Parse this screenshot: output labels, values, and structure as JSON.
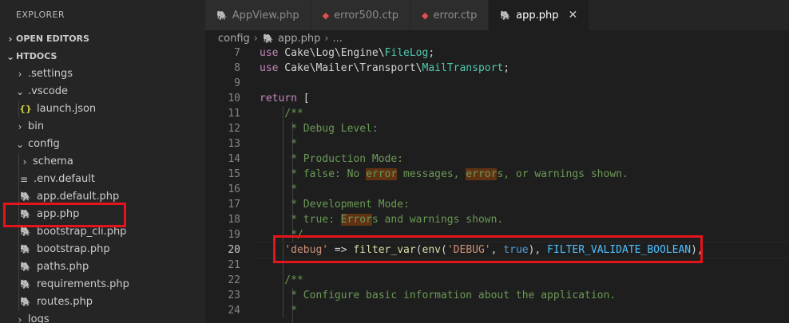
{
  "sidebar": {
    "title": "EXPLORER",
    "open_editors": "OPEN EDITORS",
    "root": "HTDOCS",
    "items": [
      {
        "label": ".settings",
        "type": "folder-collapsed",
        "depth": 1
      },
      {
        "label": ".vscode",
        "type": "folder-open",
        "depth": 1
      },
      {
        "label": "launch.json",
        "type": "json",
        "depth": 2
      },
      {
        "label": "bin",
        "type": "folder-collapsed",
        "depth": 1
      },
      {
        "label": "config",
        "type": "folder-open",
        "depth": 1
      },
      {
        "label": "schema",
        "type": "folder-collapsed",
        "depth": 2
      },
      {
        "label": ".env.default",
        "type": "env",
        "depth": 2
      },
      {
        "label": "app.default.php",
        "type": "php",
        "depth": 2
      },
      {
        "label": "app.php",
        "type": "php",
        "depth": 2
      },
      {
        "label": "bootstrap_cli.php",
        "type": "php",
        "depth": 2
      },
      {
        "label": "bootstrap.php",
        "type": "php",
        "depth": 2
      },
      {
        "label": "paths.php",
        "type": "php",
        "depth": 2
      },
      {
        "label": "requirements.php",
        "type": "php",
        "depth": 2
      },
      {
        "label": "routes.php",
        "type": "php",
        "depth": 2
      },
      {
        "label": "logs",
        "type": "folder-collapsed",
        "depth": 1
      }
    ]
  },
  "tabs": [
    {
      "label": "AppView.php",
      "icon": "php-icon"
    },
    {
      "label": "error500.ctp",
      "icon": "cake-icon"
    },
    {
      "label": "error.ctp",
      "icon": "cake-icon"
    },
    {
      "label": "app.php",
      "icon": "php-icon",
      "active": true
    }
  ],
  "breadcrumb": {
    "folder": "config",
    "file": "app.php",
    "more": "..."
  },
  "editor": {
    "lines": [
      {
        "n": "7",
        "tokens": [
          [
            "kw",
            "use"
          ],
          [
            "punct",
            " Cake\\Log\\Engine\\"
          ],
          [
            "cls",
            "FileLog"
          ],
          [
            "punct",
            ";"
          ]
        ]
      },
      {
        "n": "8",
        "tokens": [
          [
            "kw",
            "use"
          ],
          [
            "punct",
            " Cake\\Mailer\\Transport\\"
          ],
          [
            "cls",
            "MailTransport"
          ],
          [
            "punct",
            ";"
          ]
        ]
      },
      {
        "n": "9",
        "tokens": []
      },
      {
        "n": "10",
        "tokens": [
          [
            "kw",
            "return"
          ],
          [
            "punct",
            " ["
          ]
        ]
      },
      {
        "n": "11",
        "tokens": [
          [
            "cmt",
            "    /**"
          ]
        ]
      },
      {
        "n": "12",
        "tokens": [
          [
            "cmt",
            "     * Debug Level:"
          ]
        ]
      },
      {
        "n": "13",
        "tokens": [
          [
            "cmt",
            "     *"
          ]
        ]
      },
      {
        "n": "14",
        "tokens": [
          [
            "cmt",
            "     * Production Mode:"
          ]
        ]
      },
      {
        "n": "15",
        "tokens": [
          [
            "cmt",
            "     * false: No "
          ],
          [
            "cmt-hl",
            "error"
          ],
          [
            "cmt",
            " messages, "
          ],
          [
            "cmt-hl",
            "error"
          ],
          [
            "cmt",
            "s, or warnings shown."
          ]
        ]
      },
      {
        "n": "16",
        "tokens": [
          [
            "cmt",
            "     *"
          ]
        ]
      },
      {
        "n": "17",
        "tokens": [
          [
            "cmt",
            "     * Development Mode:"
          ]
        ]
      },
      {
        "n": "18",
        "tokens": [
          [
            "cmt",
            "     * true: "
          ],
          [
            "cmt-hl",
            "Error"
          ],
          [
            "cmt",
            "s and warnings shown."
          ]
        ]
      },
      {
        "n": "19",
        "tokens": [
          [
            "cmt",
            "     */"
          ]
        ]
      },
      {
        "n": "20",
        "tokens": [
          [
            "punct",
            "    "
          ],
          [
            "str",
            "'debug'"
          ],
          [
            "punct",
            " => "
          ],
          [
            "fn",
            "filter_var"
          ],
          [
            "punct",
            "("
          ],
          [
            "fn",
            "env"
          ],
          [
            "punct",
            "("
          ],
          [
            "str",
            "'DEBUG'"
          ],
          [
            "punct",
            ", "
          ],
          [
            "bool",
            "true"
          ],
          [
            "punct",
            "), "
          ],
          [
            "const",
            "FILTER_VALIDATE_BOOLEAN"
          ],
          [
            "punct",
            "),"
          ]
        ],
        "current": true
      },
      {
        "n": "21",
        "tokens": []
      },
      {
        "n": "22",
        "tokens": [
          [
            "cmt",
            "    /**"
          ]
        ]
      },
      {
        "n": "23",
        "tokens": [
          [
            "cmt",
            "     * Configure basic information about the application."
          ]
        ]
      },
      {
        "n": "24",
        "tokens": [
          [
            "cmt",
            "     *"
          ]
        ]
      }
    ]
  },
  "colors": {
    "accent_red": "#e3151a",
    "php_icon": "#a074c4",
    "cake_icon": "#e34f4f"
  }
}
